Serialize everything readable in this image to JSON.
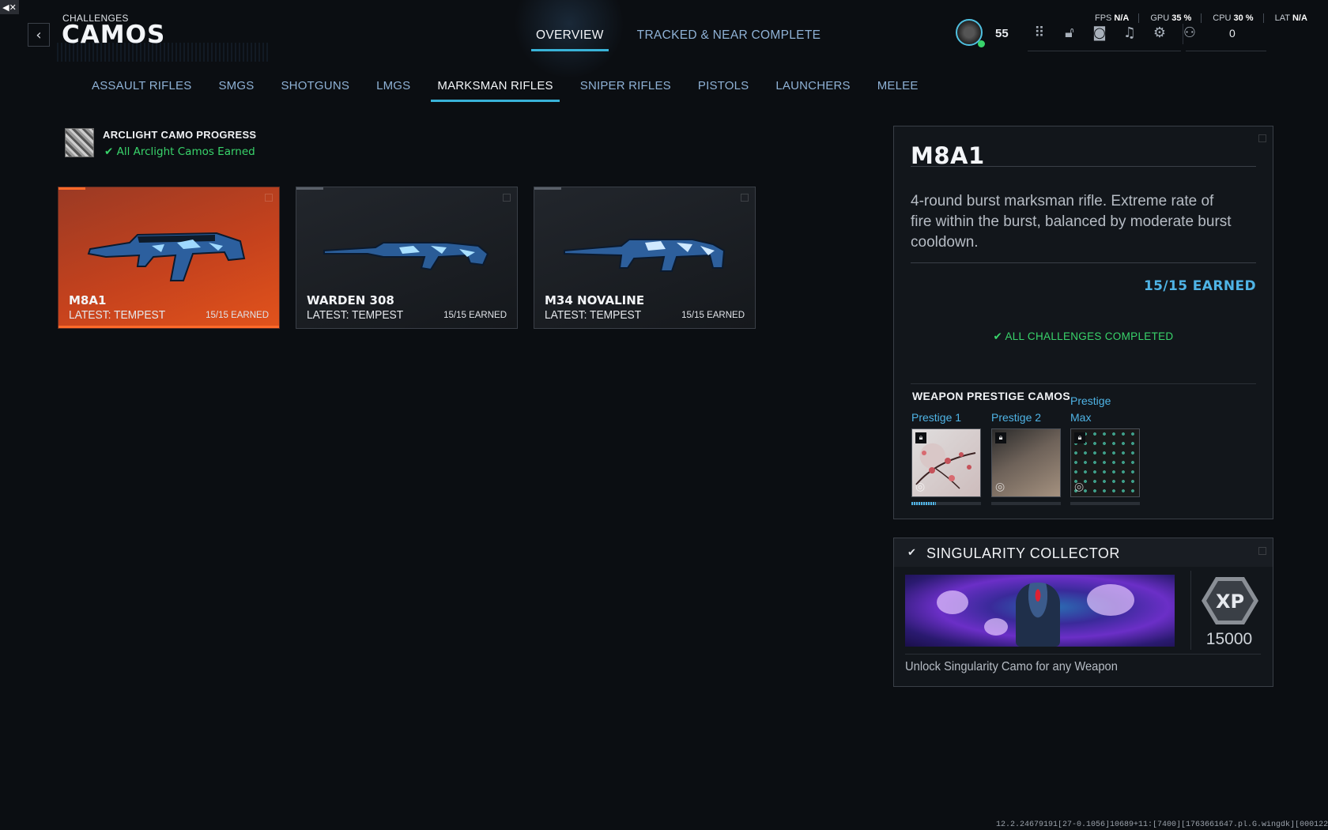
{
  "system": {
    "mute_icon": "speaker-muted-icon"
  },
  "header": {
    "breadcrumb": "CHALLENGES",
    "title": "CAMOS",
    "back_icon": "chevron-left-icon"
  },
  "top_tabs": [
    {
      "label": "OVERVIEW",
      "active": true
    },
    {
      "label": "TRACKED & NEAR COMPLETE",
      "active": false
    }
  ],
  "player": {
    "level": "55",
    "online_status_color": "#39d46b"
  },
  "toolbar_icons": [
    "grid-menu-icon",
    "lock-unlock-icon",
    "camera-icon",
    "bell-icon",
    "gear-icon"
  ],
  "party": {
    "icon": "party-icon",
    "count": "0"
  },
  "perf": [
    {
      "label": "FPS",
      "value": "N/A"
    },
    {
      "label": "GPU",
      "value": "35 %"
    },
    {
      "label": "CPU",
      "value": "30 %"
    },
    {
      "label": "LAT",
      "value": "N/A"
    }
  ],
  "categories": [
    {
      "label": "ASSAULT RIFLES",
      "active": false
    },
    {
      "label": "SMGS",
      "active": false
    },
    {
      "label": "SHOTGUNS",
      "active": false
    },
    {
      "label": "LMGS",
      "active": false
    },
    {
      "label": "MARKSMAN RIFLES",
      "active": true
    },
    {
      "label": "SNIPER RIFLES",
      "active": false
    },
    {
      "label": "PISTOLS",
      "active": false
    },
    {
      "label": "LAUNCHERS",
      "active": false
    },
    {
      "label": "MELEE",
      "active": false
    }
  ],
  "arclight": {
    "title": "ARCLIGHT CAMO PROGRESS",
    "status": "✔ All Arclight Camos Earned"
  },
  "weapons": [
    {
      "name": "M8A1",
      "latest": "LATEST: TEMPEST",
      "earned": "15/15 EARNED",
      "selected": true
    },
    {
      "name": "WARDEN 308",
      "latest": "LATEST: TEMPEST",
      "earned": "15/15 EARNED",
      "selected": false
    },
    {
      "name": "M34 NOVALINE",
      "latest": "LATEST: TEMPEST",
      "earned": "15/15 EARNED",
      "selected": false
    }
  ],
  "detail": {
    "name": "M8A1",
    "description": "4-round burst marksman rifle. Extreme rate of fire within the burst, balanced by moderate burst cooldown.",
    "earned": "15/15 EARNED",
    "completed": "✔ ALL CHALLENGES COMPLETED",
    "prestige_title": "WEAPON PRESTIGE CAMOS",
    "prestige": [
      {
        "label": "Prestige 1",
        "locked": true,
        "progress": 0.35,
        "camo": "cherry-blossom"
      },
      {
        "label": "Prestige 2",
        "locked": true,
        "progress": 0,
        "camo": "tan-gradient"
      },
      {
        "label": "Prestige Max",
        "locked": true,
        "progress": 0,
        "camo": "scale-pattern"
      }
    ]
  },
  "singularity": {
    "title": "SINGULARITY COLLECTOR",
    "completed": true,
    "xp_label": "XP",
    "xp": "15000",
    "description": "Unlock Singularity Camo for any Weapon"
  },
  "version": "12.2.24679191[27-0.1056]10689+11:[7400][1763661647.pl.G.wingdk][000122ffff]"
}
